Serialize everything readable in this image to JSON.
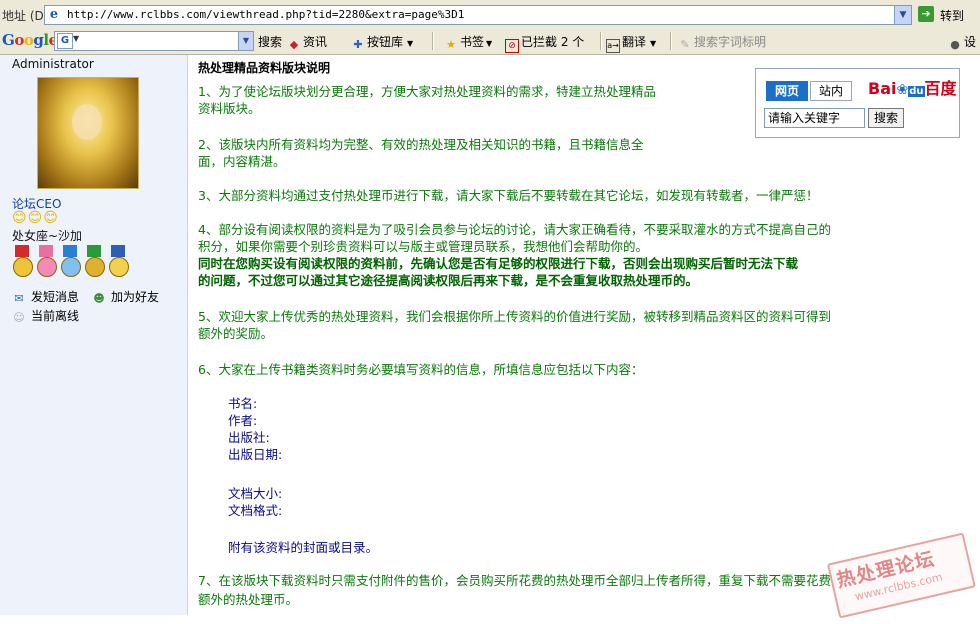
{
  "browser": {
    "address_label": "地址 (D)",
    "url": "http://www.rclbbs.com/viewthread.php?tid=2280&extra=page%3D1",
    "go_label": "转到"
  },
  "toolbar": {
    "google_logo": "Google",
    "search_glyph": "G",
    "items": {
      "search": "搜索",
      "news": "资讯",
      "buttons": "按钮库",
      "bookmarks": "书签",
      "blocked": "已拦截",
      "blocked_count": "2 个",
      "translate": "翻译",
      "highlight": "搜索字词标明",
      "settings": "设"
    }
  },
  "user": {
    "name": "Administrator",
    "rank": "论坛CEO",
    "smiles": "😊😊😊",
    "signature": "处女座~沙加",
    "pm": "发短消息",
    "add_friend": "加为好友",
    "status": "当前离线"
  },
  "post": {
    "title": "热处理精品资料版块说明",
    "p1a": "1、为了使论坛版块划分更合理，方便大家对热处理资料的需求，特建立热处理精品",
    "p1b": "资料版块。",
    "p2a": "2、该版块内所有资料均为完整、有效的热处理及相关知识的书籍，且书籍信息全",
    "p2b": "面，内容精湛。",
    "p3": "3、大部分资料均通过支付热处理币进行下载，请大家下载后不要转载在其它论坛，如发现有转载者，一律严惩！",
    "p4a": "4、部分设有阅读权限的资料是为了吸引会员参与论坛的讨论，请大家正确看待，不要采取灌水的方式不提高自己的",
    "p4b": "积分，如果你需要个别珍贵资料可以与版主或管理员联系，我想他们会帮助你的。",
    "p4c": "同时在您购买设有阅读权限的资料前，先确认您是否有足够的权限进行下载，否则会出现购买后暂时无法下载",
    "p4d": "的问题，不过您可以通过其它途径提高阅读权限后再来下载，是不会重复收取热处理币的。",
    "p5a": "5、欢迎大家上传优秀的热处理资料，我们会根据你所上传资料的价值进行奖励，被转移到精品资料区的资料可得到",
    "p5b": "额外的奖励。",
    "p6": "6、大家在上传书籍类资料时务必要填写资料的信息，所填信息应包括以下内容：",
    "fields": [
      "书名:",
      "作者:",
      "出版社:",
      "出版日期:"
    ],
    "fields2": [
      "文档大小:",
      "文档格式:"
    ],
    "cover": "附有该资料的封面或目录。",
    "p7a": "7、在该版块下载资料时只需支付附件的售价，会员购买所花费的热处理币全部归上传者所得，重复下载不需要花费",
    "p7b": "额外的热处理币。"
  },
  "baidu": {
    "tab_web": "网页",
    "tab_site": "站内",
    "logo_bai": "Bai",
    "logo_du": "du",
    "logo_cn": "百度",
    "placeholder": "请输入关键字",
    "button": "搜索"
  },
  "watermark": {
    "text": "热处理论坛",
    "url": "www.rclbbs.com"
  },
  "colors": {
    "post_text": "#0a7a0a",
    "post_bold": "#006400",
    "rank_link": "#0b3ea8",
    "baidu_blue": "#1a6fc9",
    "baidu_red": "#d0021b"
  }
}
